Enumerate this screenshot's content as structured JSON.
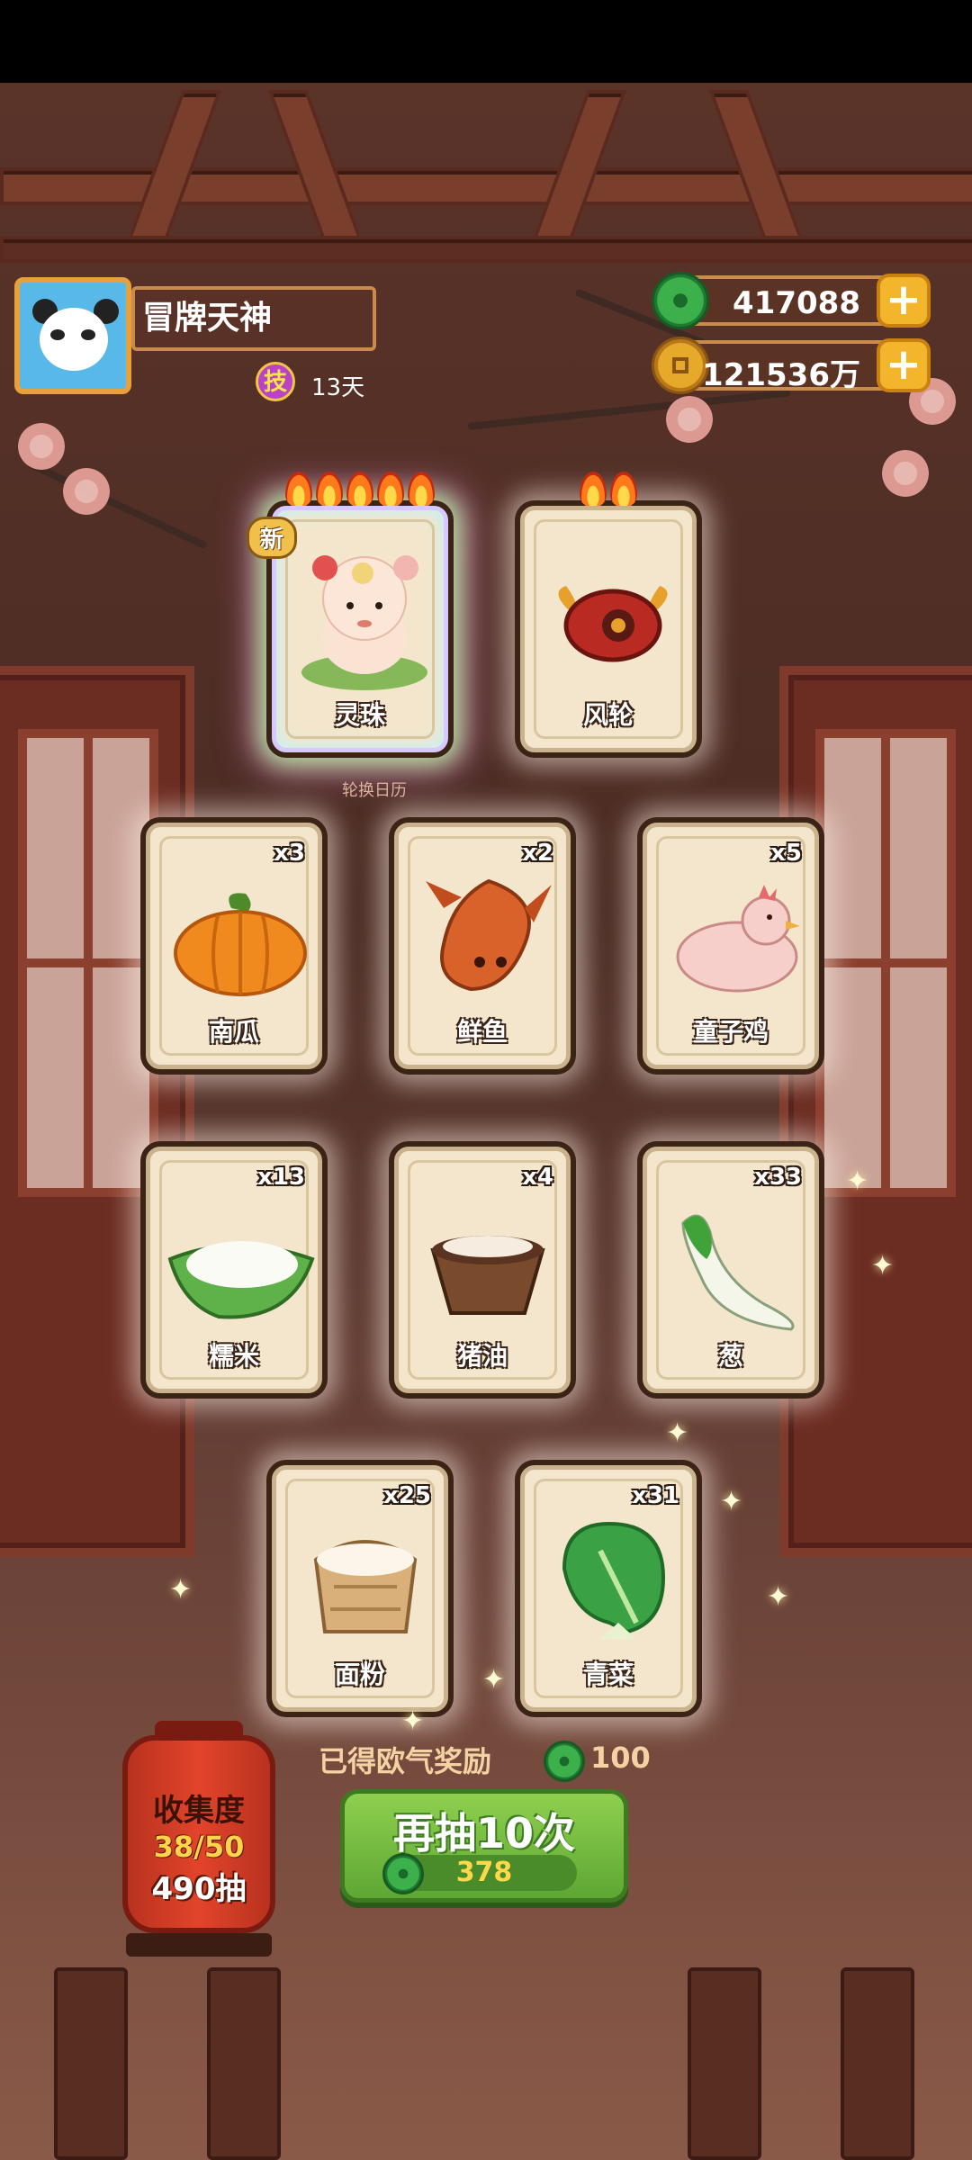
{
  "player": {
    "name": "冒牌天神",
    "skill_badge": "技",
    "skill_days": "13天"
  },
  "resources": {
    "jade": {
      "value": "417088",
      "icon": "jade-icon"
    },
    "coins": {
      "value": "121536万",
      "icon": "coin-icon"
    }
  },
  "rare_cards": [
    {
      "name": "灵珠",
      "flames": 5,
      "is_new": true,
      "new_label": "新",
      "rarity": "rainbow"
    },
    {
      "name": "风轮",
      "flames": 2,
      "is_new": false
    }
  ],
  "calendar_label": "轮换日历",
  "cards": [
    {
      "name": "南瓜",
      "count": "x3",
      "art": "pumpkin"
    },
    {
      "name": "鲜鱼",
      "count": "x2",
      "art": "fish"
    },
    {
      "name": "童子鸡",
      "count": "x5",
      "art": "chicken"
    },
    {
      "name": "糯米",
      "count": "x13",
      "art": "rice"
    },
    {
      "name": "猪油",
      "count": "x4",
      "art": "lard"
    },
    {
      "name": "葱",
      "count": "x33",
      "art": "scallion"
    },
    {
      "name": "面粉",
      "count": "x25",
      "art": "flour"
    },
    {
      "name": "青菜",
      "count": "x31",
      "art": "greens"
    }
  ],
  "reward": {
    "label": "已得欧气奖励",
    "value": "100"
  },
  "draw_button": {
    "label": "再抽10次",
    "cost": "378"
  },
  "collection": {
    "title": "收集度",
    "progress": "38/50",
    "draws": "490抽"
  },
  "colors": {
    "jade": "#3bb04b",
    "gold": "#f2b52c",
    "draw_button": "#6fb83d",
    "lantern": "#e2442a"
  }
}
